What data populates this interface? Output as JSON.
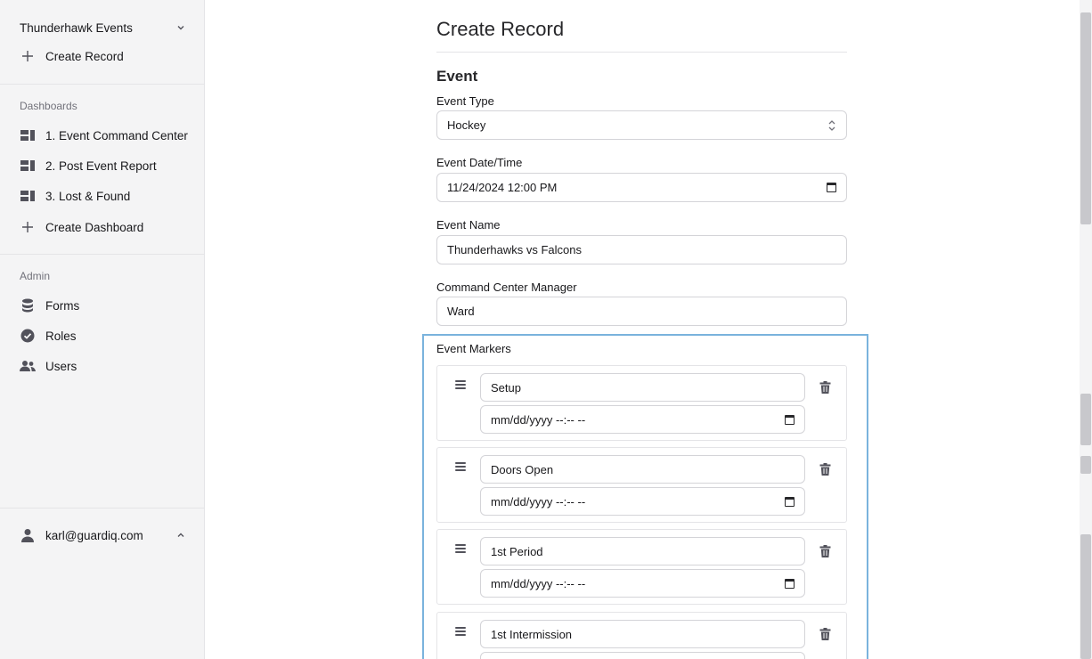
{
  "sidebar": {
    "workspace": "Thunderhawk Events",
    "create_record": "Create Record",
    "dashboards_label": "Dashboards",
    "dashboards": [
      {
        "label": "1. Event Command Center"
      },
      {
        "label": "2. Post Event Report"
      },
      {
        "label": "3. Lost & Found"
      }
    ],
    "create_dashboard": "Create Dashboard",
    "admin_label": "Admin",
    "admin_items": [
      {
        "label": "Forms",
        "icon": "database-icon"
      },
      {
        "label": "Roles",
        "icon": "check-badge-icon"
      },
      {
        "label": "Users",
        "icon": "users-icon"
      }
    ],
    "user_email": "karl@guardiq.com"
  },
  "form": {
    "title": "Create Record",
    "section": "Event",
    "fields": {
      "event_type": {
        "label": "Event Type",
        "value": "Hockey"
      },
      "event_datetime": {
        "label": "Event Date/Time",
        "value": "11/24/2024 12:00 PM"
      },
      "event_name": {
        "label": "Event Name",
        "value": "Thunderhawks vs Falcons"
      },
      "manager": {
        "label": "Command Center Manager",
        "value": "Ward"
      }
    },
    "markers_label": "Event Markers",
    "markers": [
      {
        "name": "Setup",
        "date": "mm/dd/yyyy --:-- --"
      },
      {
        "name": "Doors Open",
        "date": "mm/dd/yyyy --:-- --"
      },
      {
        "name": "1st Period",
        "date": "mm/dd/yyyy --:-- --"
      },
      {
        "name": "1st Intermission",
        "date": ""
      }
    ]
  },
  "colors": {
    "focus_border": "#7ab3dd",
    "sidebar_bg": "#f4f4f5"
  }
}
